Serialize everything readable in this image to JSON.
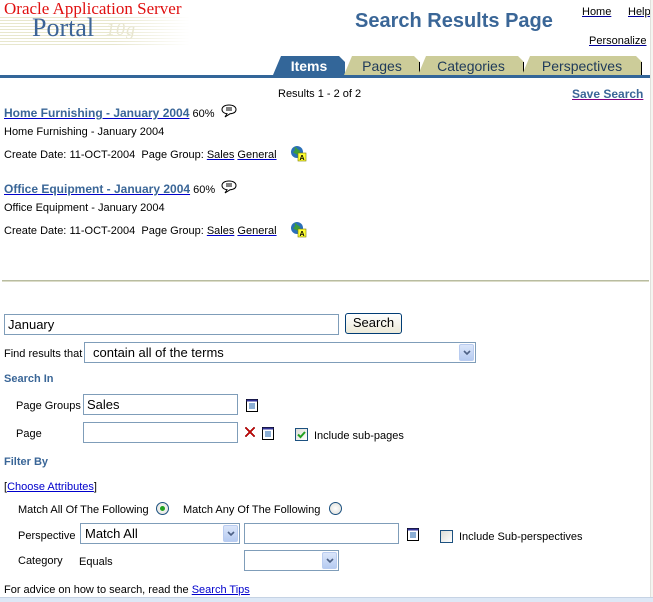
{
  "header": {
    "brand_top": "Oracle Application Server",
    "brand_product": "Portal",
    "brand_suffix": "10g",
    "page_title": "Search Results Page",
    "links": {
      "home": "Home",
      "help": "Help",
      "personalize": "Personalize"
    }
  },
  "tabs": [
    {
      "label": "Items",
      "active": true
    },
    {
      "label": "Pages",
      "active": false
    },
    {
      "label": "Categories",
      "active": false
    },
    {
      "label": "Perspectives",
      "active": false
    }
  ],
  "results": {
    "count_text": "Results 1 - 2 of 2",
    "save_search": "Save Search",
    "items": [
      {
        "title": "Home Furnishing - January 2004",
        "score": "60%",
        "description": "Home Furnishing - January 2004",
        "create_date_label": "Create Date:",
        "create_date": "11-OCT-2004",
        "page_group_label": "Page Group:",
        "page_group": "Sales",
        "page": "General"
      },
      {
        "title": "Office Equipment - January 2004",
        "score": "60%",
        "description": "Office Equipment - January 2004",
        "create_date_label": "Create Date:",
        "create_date": "11-OCT-2004",
        "page_group_label": "Page Group:",
        "page_group": "Sales",
        "page": "General"
      }
    ]
  },
  "search_form": {
    "query": "January",
    "search_button": "Search",
    "find_results_label": "Find results that",
    "find_results_value": "contain all of the terms",
    "search_in_heading": "Search In",
    "page_groups_label": "Page Groups",
    "page_groups_value": "Sales",
    "page_label": "Page",
    "page_value": "",
    "include_subpages_label": "Include sub-pages",
    "include_subpages_checked": true,
    "filter_by_heading": "Filter By",
    "choose_attributes_prefix": "[",
    "choose_attributes": "Choose Attributes",
    "choose_attributes_suffix": "]",
    "match_all_label": "Match All Of The Following",
    "match_all_selected": true,
    "match_any_label": "Match Any Of The Following",
    "perspective_label": "Perspective",
    "perspective_operator": "Match All",
    "perspective_value": "",
    "include_subperspectives_label": "Include Sub-perspectives",
    "include_subperspectives_checked": false,
    "category_label": "Category",
    "category_operator": "Equals",
    "category_value": "",
    "advice_text": "For advice on how to search, read the ",
    "search_tips": "Search Tips"
  }
}
